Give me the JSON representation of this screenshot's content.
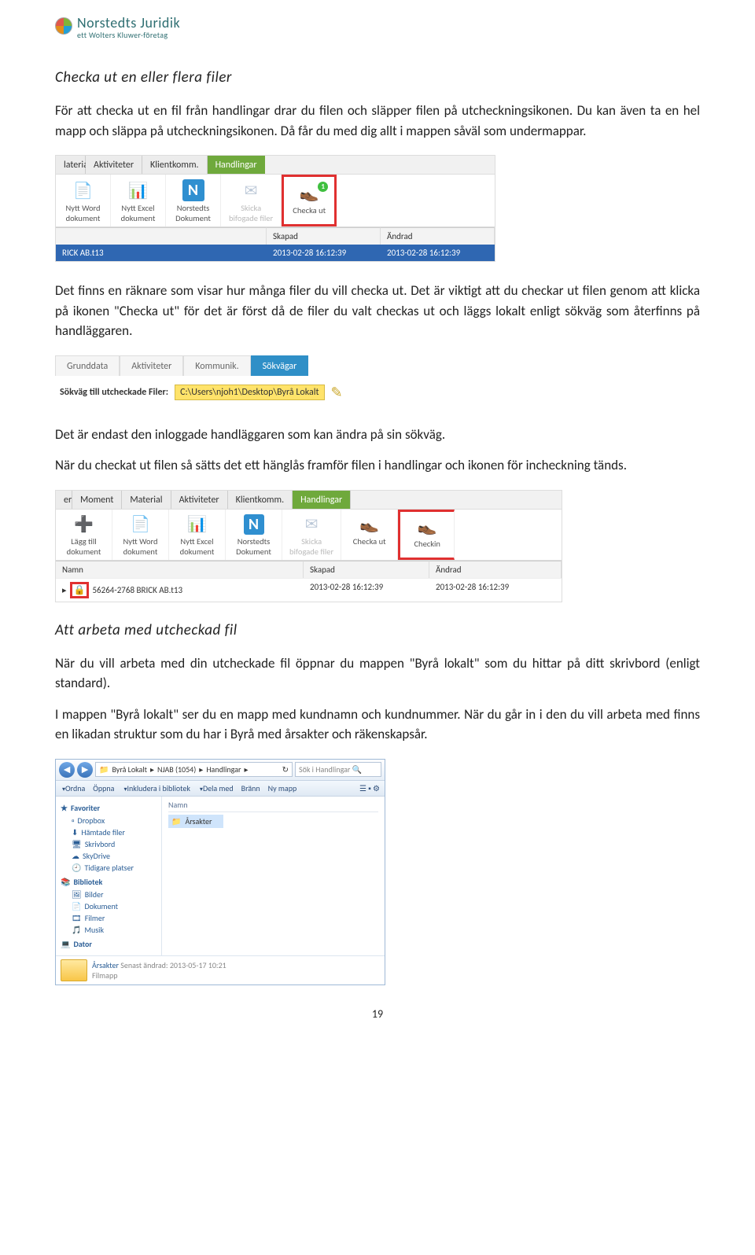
{
  "logo": {
    "brand": "Norstedts Juridik",
    "sub": "ett Wolters Kluwer-företag"
  },
  "h1": "Checka ut en eller flera filer",
  "p1": "För att checka ut en fil från handlingar drar du filen och släpper filen på utcheckningsikonen. Du kan även ta en hel mapp och släppa på utcheckningsikonen. Då får du med dig allt i mappen såväl som undermappar.",
  "shot1": {
    "tabs": [
      "laterial",
      "Aktiviteter",
      "Klientkomm.",
      "Handlingar"
    ],
    "ribbon": [
      {
        "line1": "Nytt Word",
        "line2": "dokument",
        "icon": "doc"
      },
      {
        "line1": "Nytt Excel",
        "line2": "dokument",
        "icon": "xls"
      },
      {
        "line1": "Norstedts",
        "line2": "Dokument",
        "icon": "N"
      },
      {
        "line1": "Skicka",
        "line2": "bifogade filer",
        "icon": "mail",
        "dim": true
      },
      {
        "line1": "Checka ut",
        "line2": "",
        "icon": "shoe",
        "badge": "1",
        "red": true
      }
    ],
    "cols": [
      "",
      "Skapad",
      "Ändrad"
    ],
    "row": [
      "RICK AB.t13",
      "2013-02-28 16:12:39",
      "2013-02-28 16:12:39"
    ]
  },
  "p2": "Det finns en räknare som visar hur många filer du vill checka ut. Det är viktigt att du checkar ut filen genom att klicka på ikonen \"Checka ut\" för det är först då de filer du valt checkas ut och läggs lokalt enligt sökväg som återfinns på handläggaren.",
  "shot2": {
    "tabs": [
      "Grunddata",
      "Aktiviteter",
      "Kommunik.",
      "Sökvägar"
    ],
    "label": "Sökväg till utcheckade Filer:",
    "path": "C:\\Users\\njoh1\\Desktop\\Byrå Lokalt"
  },
  "p3": "Det är endast den inloggade handläggaren som kan ändra på sin sökväg.",
  "p4": "När du checkat ut filen så sätts det ett hänglås framför filen i handlingar och ikonen för incheckning tänds.",
  "shot3": {
    "tabs": [
      "er",
      "Moment",
      "Material",
      "Aktiviteter",
      "Klientkomm.",
      "Handlingar"
    ],
    "ribbon": [
      {
        "line1": "Lägg till",
        "line2": "dokument",
        "icon": "plus"
      },
      {
        "line1": "Nytt Word",
        "line2": "dokument",
        "icon": "doc"
      },
      {
        "line1": "Nytt Excel",
        "line2": "dokument",
        "icon": "xls"
      },
      {
        "line1": "Norstedts",
        "line2": "Dokument",
        "icon": "N"
      },
      {
        "line1": "Skicka",
        "line2": "bifogade filer",
        "icon": "mail",
        "dim": true
      },
      {
        "line1": "Checka ut",
        "line2": "",
        "icon": "shoe"
      },
      {
        "line1": "Checkin",
        "line2": "",
        "icon": "shoe",
        "red": true
      }
    ],
    "cols": [
      "Namn",
      "Skapad",
      "Ändrad"
    ],
    "row": [
      "56264-2768 BRICK AB.t13",
      "2013-02-28 16:12:39",
      "2013-02-28 16:12:39"
    ]
  },
  "h2": "Att arbeta med utcheckad fil",
  "p5": "När du vill arbeta med din utcheckade fil öppnar du mappen \"Byrå lokalt\" som du hittar på ditt skrivbord (enligt standard).",
  "p6": "I mappen \"Byrå lokalt\" ser du en mapp med kundnamn och kundnummer. När du går in i den du vill arbeta med finns en likadan struktur som du har i Byrå med årsakter och räkenskapsår.",
  "explorer": {
    "crumbs": [
      "Byrå Lokalt",
      "NJAB (1054)",
      "Handlingar"
    ],
    "searchPlaceholder": "Sök i Handlingar",
    "toolbar": [
      "Ordna",
      "Öppna",
      "Inkludera i bibliotek",
      "Dela med",
      "Bränn",
      "Ny mapp"
    ],
    "favHeader": "Favoriter",
    "favs": [
      "Dropbox",
      "Hämtade filer",
      "Skrivbord",
      "SkyDrive",
      "Tidigare platser"
    ],
    "libHeader": "Bibliotek",
    "libs": [
      "Bilder",
      "Dokument",
      "Filmer",
      "Musik"
    ],
    "datorHeader": "Dator",
    "colName": "Namn",
    "folder": "Årsakter",
    "footName": "Årsakter",
    "footMeta": "Senast ändrad: 2013-05-17 10:21",
    "footType": "Filmapp"
  },
  "pageNumber": "19"
}
